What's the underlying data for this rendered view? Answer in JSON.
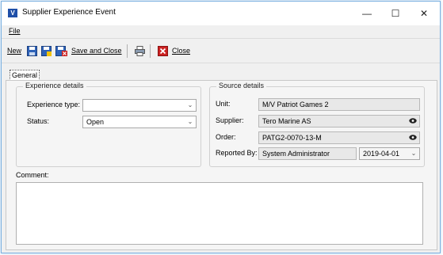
{
  "window": {
    "title": "Supplier Experience Event",
    "minimize_glyph": "—",
    "maximize_glyph": "☐",
    "close_glyph": "✕"
  },
  "menu": {
    "file": "File"
  },
  "toolbar": {
    "new": "New",
    "save_and_close": "Save and Close",
    "close": "Close"
  },
  "tabs": [
    {
      "label": "General"
    }
  ],
  "experience": {
    "title": "Experience details",
    "type_label": "Experience type:",
    "type_value": "",
    "status_label": "Status:",
    "status_value": "Open"
  },
  "source": {
    "title": "Source details",
    "unit_label": "Unit:",
    "unit_value": "M/V Patriot Games 2",
    "supplier_label": "Supplier:",
    "supplier_value": "Tero Marine AS",
    "order_label": "Order:",
    "order_value": "PATG2-0070-13-M",
    "reported_by_label": "Reported By:",
    "reported_by_value": "System Administrator",
    "date_value": "2019-04-01"
  },
  "comment": {
    "label": "Comment:",
    "value": ""
  },
  "icons": {
    "app": "app-logo-icon",
    "save": "save-icon",
    "save_new": "save-new-icon",
    "save_delete": "save-delete-icon",
    "print": "print-icon",
    "close": "close-icon",
    "view": "eye-icon",
    "dropdown": "chevron-down-icon"
  },
  "colors": {
    "accent": "#1f4fa8",
    "frame_border": "#7ab0e0",
    "close_red": "#cc2222"
  }
}
